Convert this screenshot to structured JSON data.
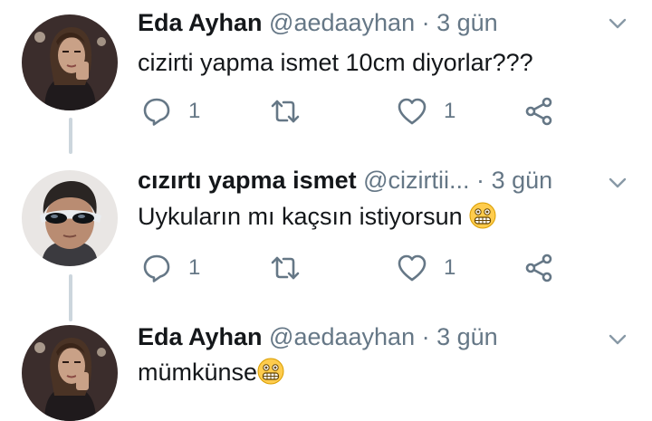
{
  "tweets": [
    {
      "name": "Eda Ayhan",
      "handle": "@aedaayhan",
      "separator": "·",
      "time": "3 gün",
      "text": "cizirti yapma ismet 10cm diyorlar???",
      "reply_count": "1",
      "like_count": "1",
      "avatar": "woman-selfie-avatar"
    },
    {
      "name": "cızırtı yapma ismet",
      "handle": "@cizirtii...",
      "separator": "·",
      "time": "3 gün",
      "text": "Uykuların mı kaçsın istiyorsun",
      "emoji": "grimacing-face-emoji",
      "reply_count": "1",
      "like_count": "1",
      "avatar": "boy-sunglasses-avatar"
    },
    {
      "name": "Eda Ayhan",
      "handle": "@aedaayhan",
      "separator": "·",
      "time": "3 gün",
      "text": "mümkünse",
      "emoji": "grimacing-face-emoji",
      "avatar": "woman-selfie-avatar"
    }
  ],
  "icons": {
    "reply": "reply-icon",
    "retweet": "retweet-icon",
    "like": "like-icon",
    "share": "share-icon",
    "more": "chevron-down-icon"
  },
  "colors": {
    "text": "#14171a",
    "secondary": "#657786",
    "thread_line": "#ccd6dd",
    "emoji": "#ffcc4d"
  }
}
